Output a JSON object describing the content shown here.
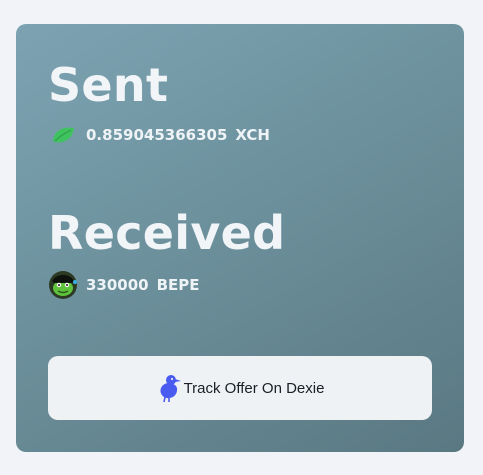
{
  "sent": {
    "heading": "Sent",
    "amount": "0.859045366305",
    "ticker": "XCH",
    "icon": "chia-leaf-icon"
  },
  "received": {
    "heading": "Received",
    "amount": "330000",
    "ticker": "BEPE",
    "icon": "bepe-token-avatar"
  },
  "dexie_button": {
    "label": "Track Offer On Dexie",
    "icon": "dexie-bird-icon"
  },
  "colors": {
    "page_bg": "#f1f3f8",
    "card_gradient_start": "#7da3b3",
    "card_gradient_end": "#5a7882",
    "chia_green": "#3fc35e",
    "dexie_blue": "#4a5cf0",
    "button_bg": "#eef2f5"
  }
}
